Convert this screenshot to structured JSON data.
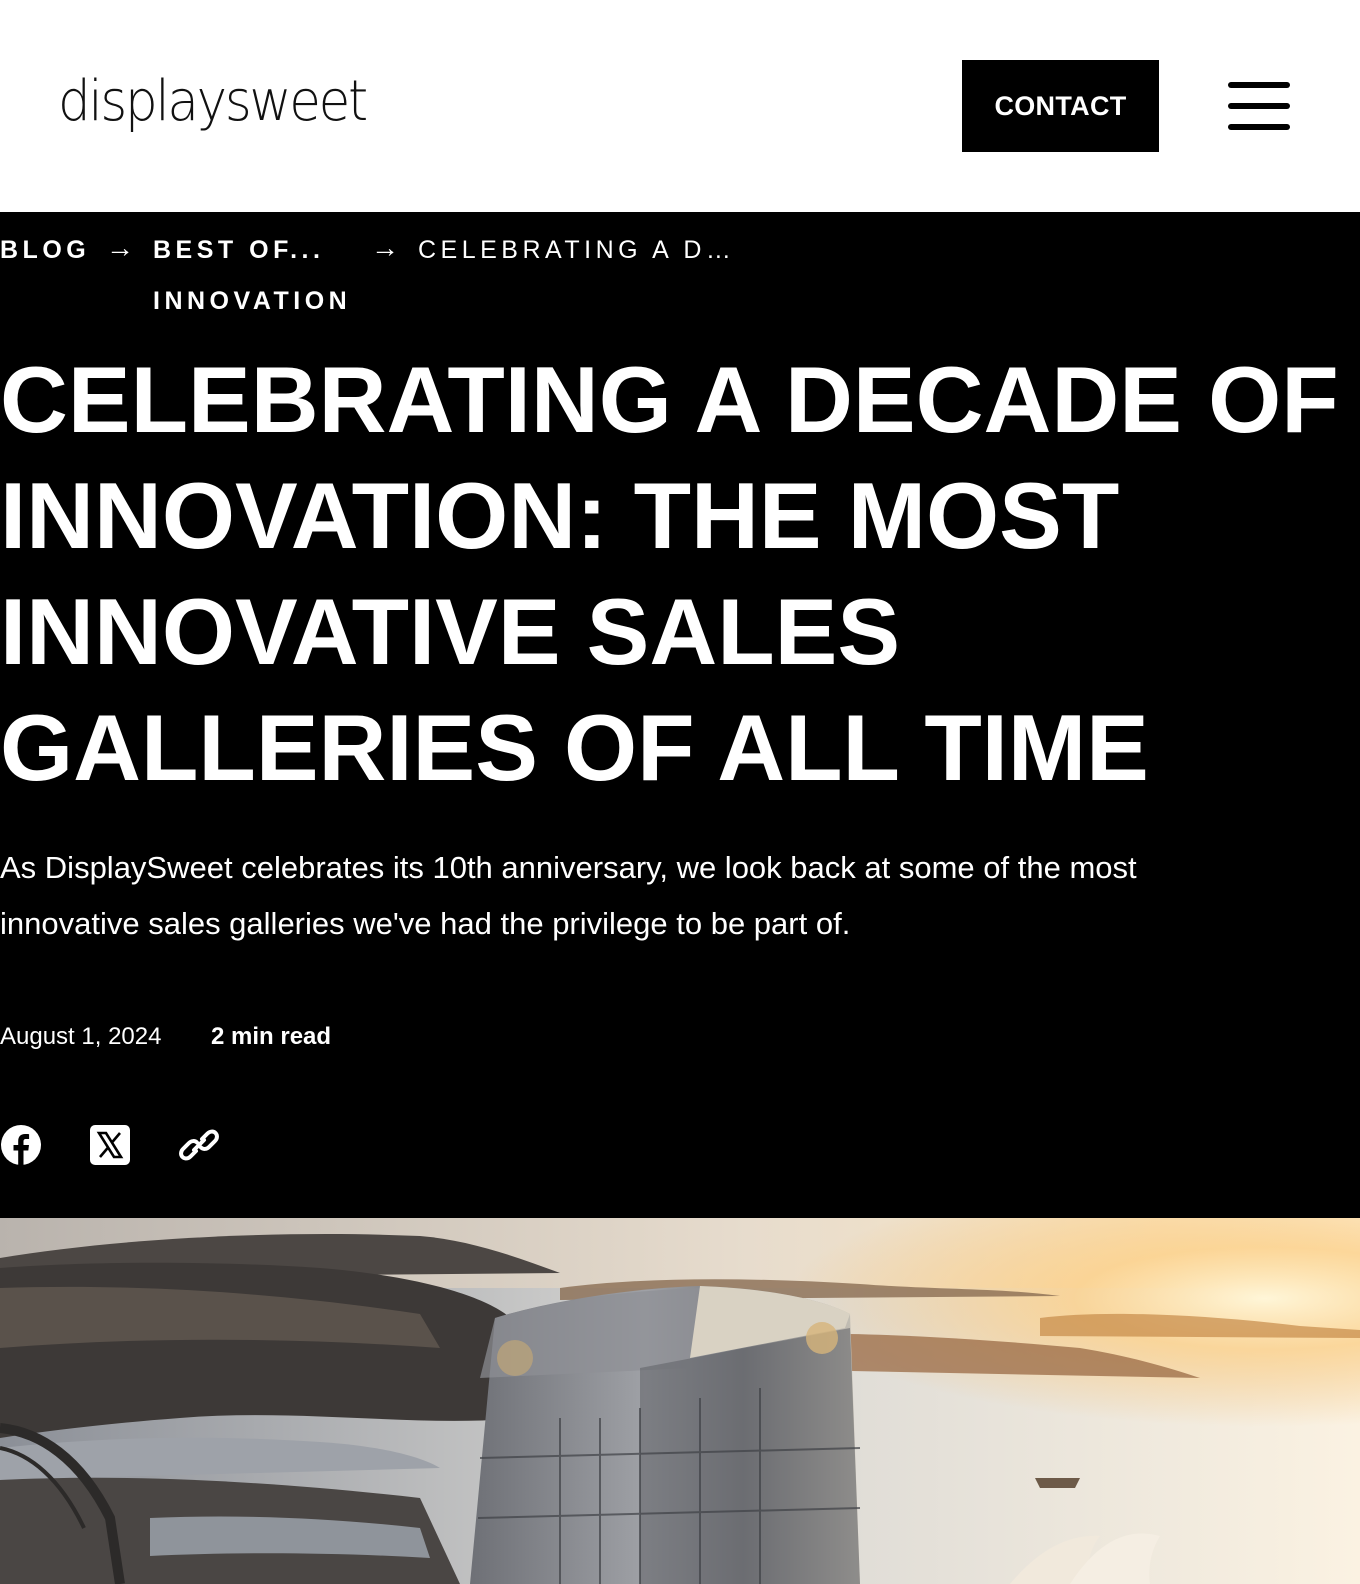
{
  "header": {
    "logo_text": "displaysweet",
    "contact_label": "CONTACT"
  },
  "breadcrumb": {
    "items": [
      {
        "label": "BLOG"
      },
      {
        "label_line1": "BEST OF...",
        "label_line2": "INNOVATION"
      },
      {
        "label": "CELEBRATING A D…"
      }
    ]
  },
  "article": {
    "title_lines": [
      "CELEBRATING A DECADE OF",
      "INNOVATION: THE MOST",
      "INNOVATIVE SALES",
      "GALLERIES OF ALL TIME"
    ],
    "intro_line1": "As DisplaySweet celebrates its 10th anniversary, we look back at some of the most",
    "intro_line2": "innovative sales galleries we've had the privilege to be part of.",
    "date": "August 1, 2024",
    "read_time": "2 min read"
  },
  "share": {
    "icons": [
      "facebook-icon",
      "x-icon",
      "link-icon"
    ]
  },
  "colors": {
    "background": "#000000",
    "header_background": "#ffffff",
    "text": "#ffffff",
    "button": "#000000"
  }
}
